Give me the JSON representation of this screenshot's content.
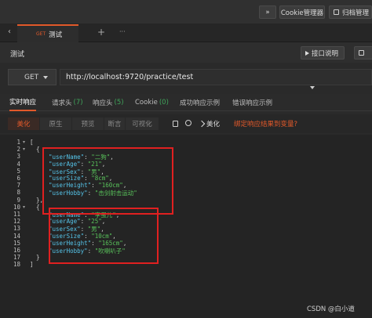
{
  "toolbar": {
    "expand_label": "»",
    "cookie_label": "Cookie管理器",
    "docs_label": "归档管理"
  },
  "tabs": {
    "nav_left": "‹",
    "active_method": "GET",
    "active_name": "测试",
    "add": "+",
    "more": "···"
  },
  "request": {
    "title": "测试",
    "api_doc_label": "接口说明",
    "method": "GET",
    "url": "http://localhost:9720/practice/test"
  },
  "response_tabs": [
    {
      "label": "实时响应",
      "count": ""
    },
    {
      "label": "请求头",
      "count": "(7)"
    },
    {
      "label": "响应头",
      "count": "(5)"
    },
    {
      "label": "Cookie",
      "count": "(0)"
    },
    {
      "label": "成功响应示例",
      "count": ""
    },
    {
      "label": "错误响应示例",
      "count": ""
    }
  ],
  "format_bar": {
    "modes": [
      "美化",
      "原生",
      "预览",
      "断言",
      "可视化"
    ],
    "beautify_label": "美化",
    "bind_label": "绑定响应结果到变量?"
  },
  "code": {
    "line_numbers": [
      "1",
      "2",
      "3",
      "4",
      "5",
      "6",
      "7",
      "8",
      "9",
      "10",
      "11",
      "12",
      "13",
      "14",
      "15",
      "16",
      "17",
      "18"
    ],
    "records": [
      [
        {
          "key": "\"userName\"",
          "value": "\"二狗\""
        },
        {
          "key": "\"userAge\"",
          "value": "\"21\""
        },
        {
          "key": "\"userSex\"",
          "value": "\"男\""
        },
        {
          "key": "\"userSize\"",
          "value": "\"8cm\""
        },
        {
          "key": "\"userHeight\"",
          "value": "\"160cm\""
        },
        {
          "key": "\"userHobby\"",
          "value": "\"击剑射击运动\""
        }
      ],
      [
        {
          "key": "\"userName\"",
          "value": "\"李蛋儿\""
        },
        {
          "key": "\"userAge\"",
          "value": "\"25\""
        },
        {
          "key": "\"userSex\"",
          "value": "\"男\""
        },
        {
          "key": "\"userSize\"",
          "value": "\"10cm\""
        },
        {
          "key": "\"userHeight\"",
          "value": "\"165cm\""
        },
        {
          "key": "\"userHobby\"",
          "value": "\"吹喇叭子\""
        }
      ]
    ]
  },
  "watermark": "CSDN @白小道",
  "colors": {
    "accent": "#e2592a",
    "key": "#55c3e8",
    "string": "#58c15a",
    "highlight_box": "#e02020"
  }
}
